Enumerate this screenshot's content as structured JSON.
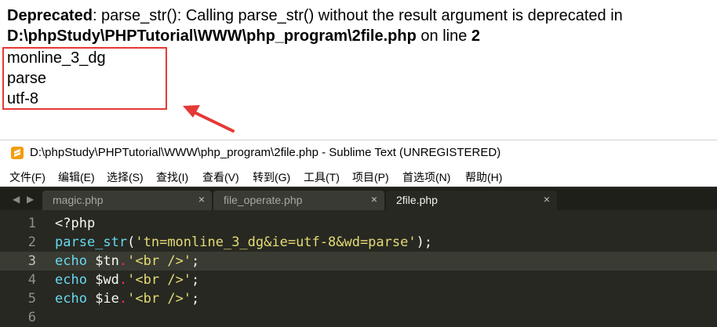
{
  "notice": {
    "level": "Deprecated",
    "message": ": parse_str(): Calling parse_str() without the result argument is deprecated in",
    "file": "D:\\phpStudy\\PHPTutorial\\WWW\\php_program\\2file.php",
    "on_line_text": " on line ",
    "line": "2"
  },
  "output": [
    "monline_3_dg",
    "parse",
    "utf-8"
  ],
  "annotation_color": "#e53935",
  "editor": {
    "window_title": "D:\\phpStudy\\PHPTutorial\\WWW\\php_program\\2file.php - Sublime Text (UNREGISTERED)",
    "menu": [
      "文件(F)",
      "编辑(E)",
      "选择(S)",
      "查找(I)",
      "查看(V)",
      "转到(G)",
      "工具(T)",
      "项目(P)",
      "首选项(N)",
      "帮助(H)"
    ],
    "tabs": [
      {
        "label": "magic.php",
        "active": false
      },
      {
        "label": "file_operate.php",
        "active": false
      },
      {
        "label": "2file.php",
        "active": true
      }
    ],
    "tab_close": "×",
    "line_numbers": [
      "1",
      "2",
      "3",
      "4",
      "5",
      "6"
    ],
    "current_line": 3,
    "code": {
      "l1": "<?php",
      "l2_fn": "parse_str",
      "l2_open": "(",
      "l2_str": "'tn=monline_3_dg&ie=utf-8&wd=parse'",
      "l2_close": ");",
      "l3_kw": "echo",
      "l3_var": " $tn",
      "l3_dot": ".",
      "l3_str": "'<br />'",
      "l3_end": ";",
      "l4_kw": "echo",
      "l4_var": " $wd",
      "l4_dot": ".",
      "l4_str": "'<br />'",
      "l4_end": ";",
      "l5_kw": "echo",
      "l5_var": " $ie",
      "l5_dot": ".",
      "l5_str": "'<br />'",
      "l5_end": ";"
    },
    "theme": {
      "background": "#272822",
      "keyword": "#66d9ef",
      "string": "#e6db74",
      "operator": "#f92672",
      "text": "#f8f8f2"
    }
  }
}
